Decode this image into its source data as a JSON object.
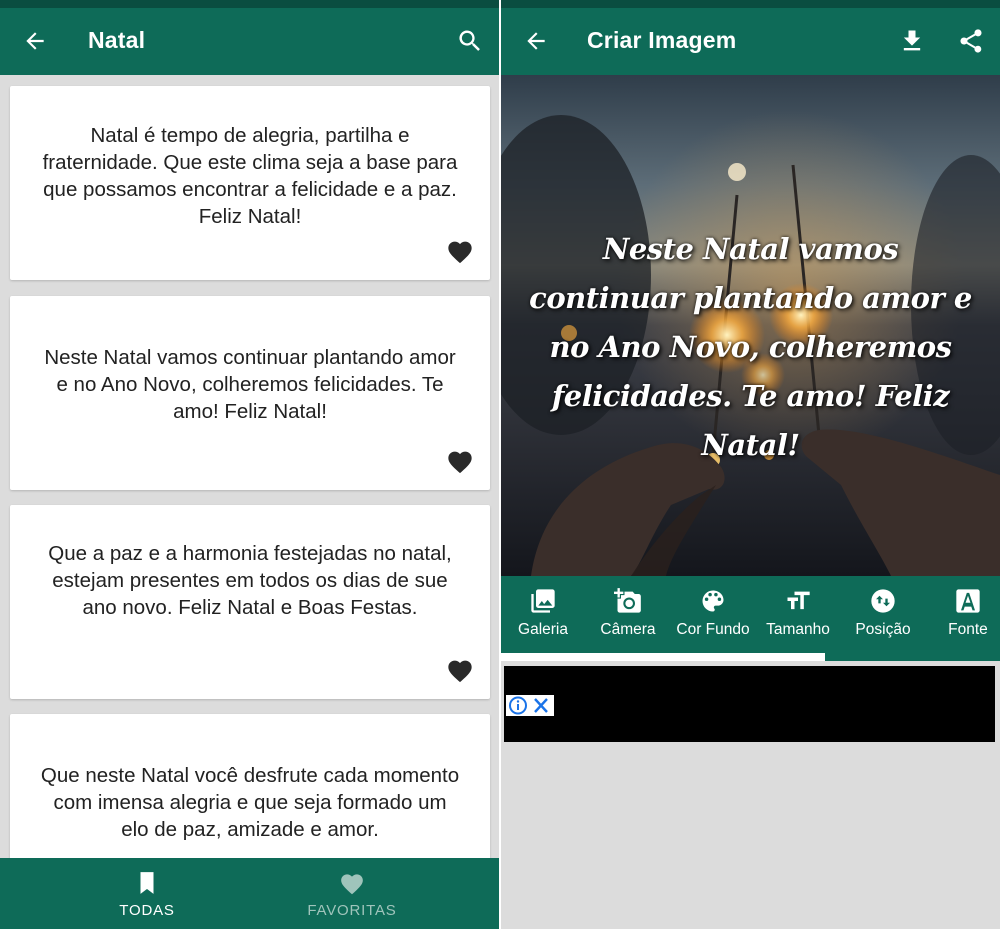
{
  "left": {
    "appbar": {
      "title": "Natal",
      "back_icon": "arrow-left-icon",
      "search_icon": "search-icon"
    },
    "cards": [
      {
        "text": "Natal é tempo de alegria, partilha e fraternidade. Que este clima seja a base para que possamos encontrar a felicidade e a paz. Feliz Natal!"
      },
      {
        "text": "Neste Natal vamos continuar plantando amor e no Ano Novo, colheremos felicidades. Te amo! Feliz Natal!"
      },
      {
        "text": "Que a paz e a harmonia festejadas no natal, estejam presentes em todos os dias de sue ano novo. Feliz Natal e Boas Festas."
      },
      {
        "text": "Que neste Natal você desfrute cada momento com imensa alegria e que seja formado um elo de paz, amizade e amor."
      }
    ],
    "bottom_nav": {
      "todas": "TODAS",
      "favoritas": "FAVORITAS",
      "active": "TODAS"
    }
  },
  "right": {
    "appbar": {
      "title": "Criar Imagem",
      "back_icon": "arrow-left-icon",
      "download_icon": "download-icon",
      "share_icon": "share-icon"
    },
    "overlay_text": "Neste Natal vamos continuar plantando amor e no Ano Novo, colheremos felicidades. Te amo! Feliz Natal!",
    "tools": [
      {
        "label": "Galeria",
        "icon": "gallery-icon"
      },
      {
        "label": "Câmera",
        "icon": "camera-icon"
      },
      {
        "label": "Cor Fundo",
        "icon": "palette-icon"
      },
      {
        "label": "Tamanho",
        "icon": "text-size-icon"
      },
      {
        "label": "Posição",
        "icon": "position-icon"
      },
      {
        "label": "Fonte",
        "icon": "font-icon"
      }
    ],
    "tool_scroll_fraction": 0.65
  },
  "colors": {
    "primary": "#0e6b58",
    "primary_dark": "#0a4d40",
    "background": "#dcdcdc",
    "inactive_nav": "#9fc4bb"
  }
}
